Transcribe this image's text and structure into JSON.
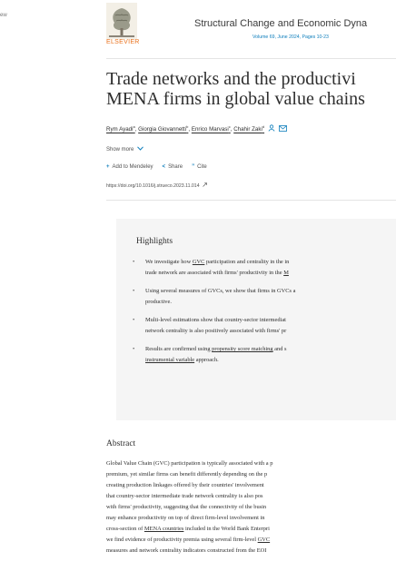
{
  "sidebar": {
    "stub_text": "ew"
  },
  "header": {
    "publisher_word": "ELSEVIER",
    "journal_title": "Structural Change and Economic Dyna",
    "journal_volume": "Volume 69, June 2024, Pages 10-23"
  },
  "article": {
    "title_line1": "Trade networks and the productivi",
    "title_line2": "MENA firms in global value chains",
    "authors": [
      {
        "name": "Rym Ayadi",
        "sup": "a"
      },
      {
        "name": "Giorgia Giovannetti",
        "sup": "b"
      },
      {
        "name": "Enrico Marvasi",
        "sup": "c"
      },
      {
        "name": "Chahir Zaki",
        "sup": "d"
      }
    ],
    "show_more": "Show more",
    "actions": {
      "add": {
        "glyph": "+",
        "label": "Add to Mendeley"
      },
      "share": {
        "glyph": "<",
        "label": "Share"
      },
      "cite": {
        "glyph": "”",
        "label": "Cite"
      }
    },
    "doi": "https://doi.org/10.1016/j.strueco.2023.11.014"
  },
  "highlights": {
    "title": "Highlights",
    "items": [
      {
        "l1a": "We investigate how ",
        "l1u": "GVC",
        "l1b": " participation and centrality in the in",
        "l2a": "trade network are associated with firms' productivity in the ",
        "l2u": "M"
      },
      {
        "l1": "Using several measures of GVCs, we show that firms in GVCs a",
        "l2": "productive."
      },
      {
        "l1": "Multi-level estimations show that country-sector intermediat",
        "l2": "network centrality is also positively associated with firms' pr"
      },
      {
        "l1a": "Results are confirmed using ",
        "l1u": "propensity score matching",
        "l1b": " and s",
        "l2u": "instrumental variable",
        "l2b": " approach."
      }
    ]
  },
  "abstract": {
    "title": "Abstract",
    "line1": "Global Value Chain (GVC) participation is typically associated with a p",
    "line2": "premium, yet similar firms can benefit differently depending on the p",
    "line3": "creating production linkages offered by their countries' involvement",
    "line4": "that country-sector intermediate trade network centrality is also pos",
    "line5": "with firms' productivity, suggesting that the connectivity of the busin",
    "line6": "may enhance productivity on top of direct firm-level involvement in",
    "line7a": "cross-section of ",
    "line7u": "MENA countries",
    "line7b": " included in the World Bank Enterpri",
    "line8a": "we find evidence of productivity premia using several firm-level ",
    "line8u": "GVC",
    "line9": "measures and network centrality indicators constructed from the EOI"
  },
  "colors": {
    "accent": "#0c7dbb",
    "elsevier": "#e9711c",
    "highlights_bg": "#f5f5f5"
  }
}
